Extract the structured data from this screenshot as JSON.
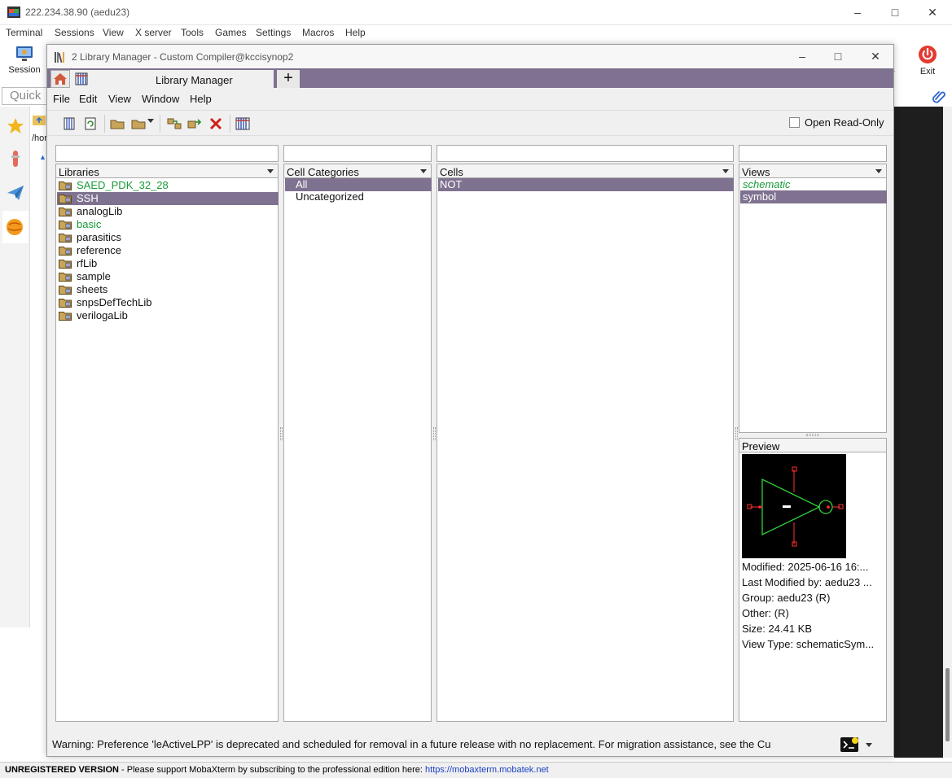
{
  "moba": {
    "title": "222.234.38.90 (aedu23)",
    "menu": [
      "Terminal",
      "Sessions",
      "View",
      "X server",
      "Tools",
      "Games",
      "Settings",
      "Macros",
      "Help"
    ],
    "session_label": "Session",
    "exit_label": "Exit",
    "quick_placeholder": "Quick",
    "path_fragment": "/hor",
    "status_unregistered": "UNREGISTERED VERSION",
    "status_message": " -  Please support MobaXterm by subscribing to the professional edition here: ",
    "status_link": "https://mobaxterm.mobatek.net",
    "hidden_toolbar_fragment": "r"
  },
  "lm": {
    "window_title": "2 Library Manager - Custom Compiler@kccisynop2",
    "tab_label": "Library Manager",
    "menu": [
      "File",
      "Edit",
      "View",
      "Window",
      "Help"
    ],
    "open_readonly_label": "Open Read-Only",
    "panels": {
      "libraries": {
        "header": "Libraries",
        "items": [
          {
            "label": "SAED_PDK_32_28",
            "green": true,
            "selected": false
          },
          {
            "label": "SSH",
            "green": false,
            "selected": true
          },
          {
            "label": "analogLib",
            "green": false,
            "selected": false
          },
          {
            "label": "basic",
            "green": true,
            "selected": false
          },
          {
            "label": "parasitics",
            "green": false,
            "selected": false
          },
          {
            "label": "reference",
            "green": false,
            "selected": false
          },
          {
            "label": "rfLib",
            "green": false,
            "selected": false
          },
          {
            "label": "sample",
            "green": false,
            "selected": false
          },
          {
            "label": "sheets",
            "green": false,
            "selected": false
          },
          {
            "label": "snpsDefTechLib",
            "green": false,
            "selected": false
          },
          {
            "label": "verilogaLib",
            "green": false,
            "selected": false
          }
        ]
      },
      "categories": {
        "header": "Cell Categories",
        "items": [
          {
            "label": "All",
            "selected": true
          },
          {
            "label": "Uncategorized",
            "selected": false
          }
        ]
      },
      "cells": {
        "header": "Cells",
        "items": [
          {
            "label": "NOT",
            "selected": true
          }
        ]
      },
      "views": {
        "header": "Views",
        "items": [
          {
            "label": "schematic",
            "italic_green": true,
            "selected": false
          },
          {
            "label": "symbol",
            "italic_green": false,
            "selected": true
          }
        ]
      }
    },
    "preview": {
      "header": "Preview",
      "lines": [
        "Modified: 2025-06-16 16:...",
        "Last Modified by: aedu23 ...",
        "Group: aedu23 (R)",
        "Other: (R)",
        "Size: 24.41 KB",
        "View Type: schematicSym..."
      ]
    },
    "status_warning": "Warning: Preference 'leActiveLPP' is deprecated and scheduled for removal in a future release with no replacement. For migration assistance, see the Cu"
  },
  "colors": {
    "accent_purple": "#7f7290",
    "green_text": "#1a9a3a",
    "link_blue": "#1a3fc4"
  }
}
